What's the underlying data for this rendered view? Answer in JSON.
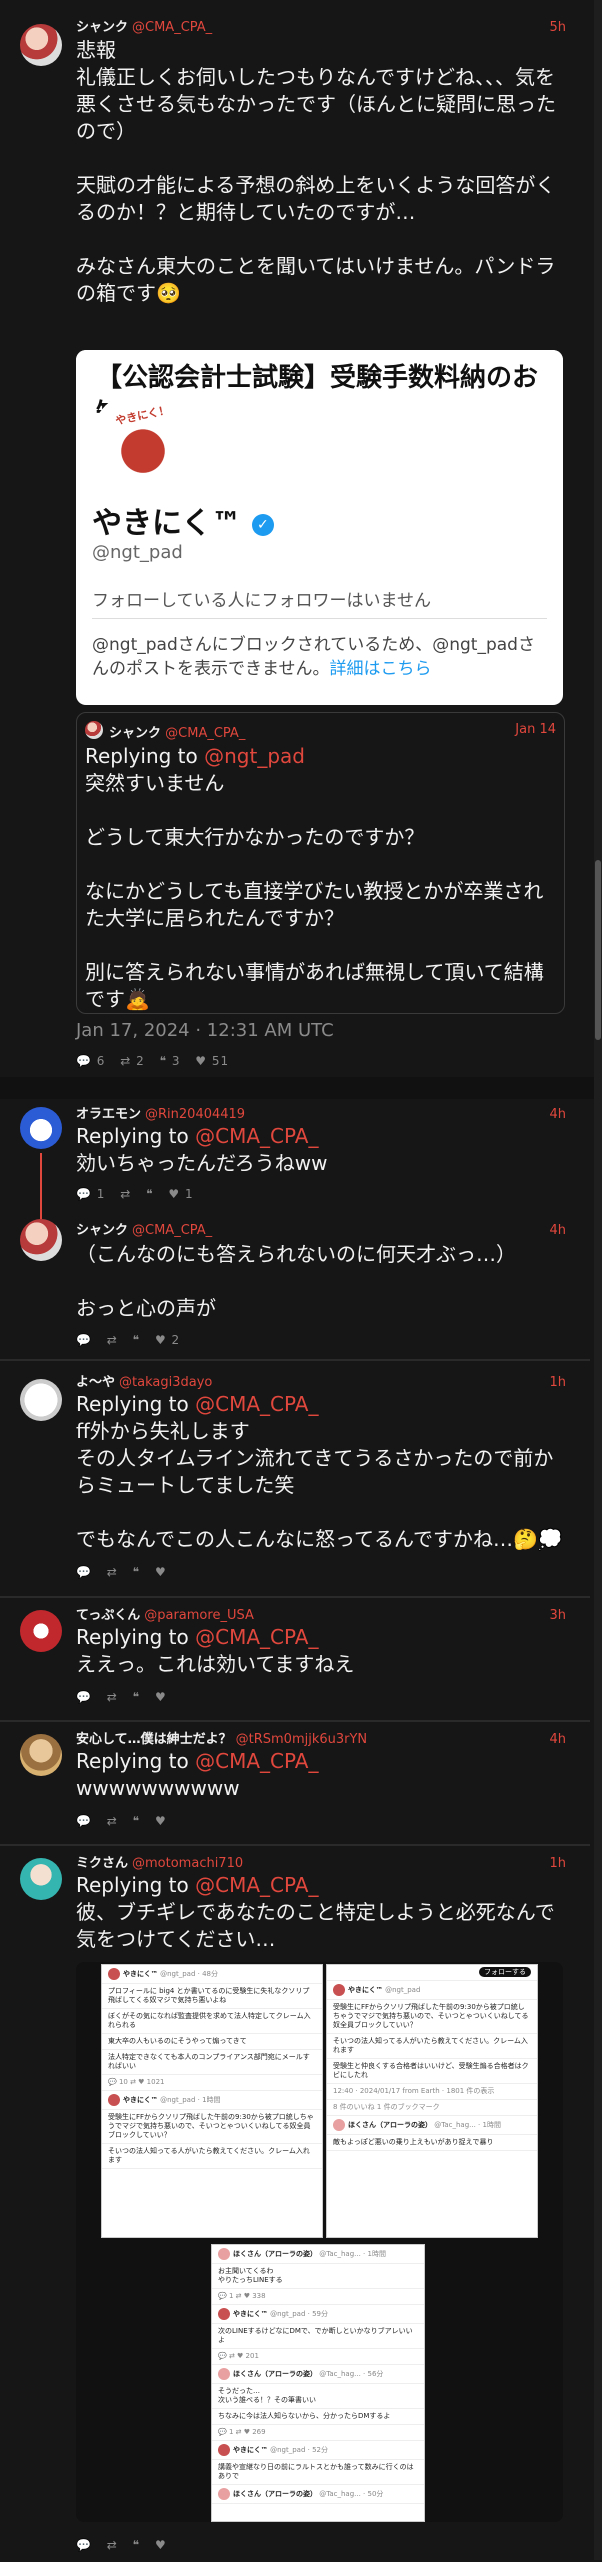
{
  "posts": [
    {
      "name": "シャンク",
      "handle": "@CMA_CPA_",
      "time": "5h",
      "body": "悲報\n礼儀正しくお伺いしたつもりなんですけどね、、、気を悪くさせる気もなかったです（ほんとに疑問に思ったので）\n\n天賦の才能による予想の斜め上をいくような回答がくるのか！？と期待していたのですが…\n\nみなさん東大のことを聞いてはいけません。パンドラの箱です🥺",
      "card": {
        "banner": "【公認会計士試験】受験手数料納のお知らせ",
        "banner_badge": "公",
        "logo_text": "やきにく！",
        "display_name": "やきにく™",
        "handle": "@ngt_pad",
        "followers_note": "フォローしている人にフォロワーはいません",
        "blocked_note": "@ngt_padさんにブロックされているため、@ngt_padさんのポストを表示できません。",
        "details_link": "詳細はこちら"
      },
      "quote": {
        "name": "シャンク",
        "handle": "@CMA_CPA_",
        "time": "Jan 14",
        "replying_prefix": "Replying to ",
        "replying_to": "@ngt_pad",
        "body": "突然すいません\n\nどうして東大行かなかったのですか？\n\nなにかどうしても直接学びたい教授とかが卒業された大学に居られたんですか？\n\n別に答えられない事情があれば無視して頂いて結構です🙇"
      },
      "timestamp": "Jan 17, 2024 · 12:31 AM UTC",
      "stats": [
        "💬 6",
        "⇄ 2",
        "❝ 3",
        "♥ 51"
      ]
    },
    {
      "name": "オラエモン",
      "handle": "@Rin20404419",
      "time": "4h",
      "replying_prefix": "Replying to ",
      "replying_to": "@CMA_CPA_",
      "body": "効いちゃったんだろうねww",
      "stats": [
        "💬 1",
        "⇄",
        "❝",
        "♥ 1"
      ]
    },
    {
      "name": "シャンク",
      "handle": "@CMA_CPA_",
      "time": "4h",
      "body": "（こんなのにも答えられないのに何天才ぶっ…）\n\nおっと心の声が",
      "stats": [
        "💬",
        "⇄",
        "❝",
        "♥ 2"
      ]
    },
    {
      "name": "よ〜や",
      "handle": "@takagi3dayo",
      "time": "1h",
      "replying_prefix": "Replying to ",
      "replying_to": "@CMA_CPA_",
      "body": "ff外から失礼します\nその人タイムライン流れてきてうるさかったので前からミュートしてました笑\n\nでもなんでこの人こんなに怒ってるんですかね…🤔💭",
      "stats": [
        "💬",
        "⇄",
        "❝",
        "♥"
      ]
    },
    {
      "name": "てっぷくん",
      "handle": "@paramore_USA",
      "time": "3h",
      "replying_prefix": "Replying to ",
      "replying_to": "@CMA_CPA_",
      "body": "ええっ。これは効いてますねえ",
      "stats": [
        "💬",
        "⇄",
        "❝",
        "♥"
      ]
    },
    {
      "name": "安心して…僕は紳士だよ？",
      "handle": "@tRSm0mjjk6u3rYN",
      "time": "4h",
      "replying_prefix": "Replying to ",
      "replying_to": "@CMA_CPA_",
      "body": "wwwwwwwwww",
      "stats": [
        "💬",
        "⇄",
        "❝",
        "♥"
      ]
    },
    {
      "name": "ミクさん",
      "handle": "@motomachi710",
      "time": "1h",
      "replying_prefix": "Replying to ",
      "replying_to": "@CMA_CPA_",
      "body": "彼、ブチギレであなたのこと特定しようと必死なんで気をつけてください…",
      "stats": [
        "💬",
        "⇄",
        "❝",
        "♥"
      ]
    }
  ],
  "embedded": {
    "s1_name": "やきにく™",
    "s1_handle": "@ngt_pad · 48分",
    "s1_text1": "プロフィールに big4 とか書いてるのに受験生に失礼なクソリプ飛ばしてくる奴マジで気持ち悪いよね",
    "s1_text2": "ぼくがその気になれば監査提供を求めて法人特定してクレーム入れられる",
    "s1_text3": "東大卒の人もいるのにそうやって煽ってきて",
    "s1_text4": "法人特定できなくても本人のコンプライアンス部門宛にメールすればいい",
    "s1_stats": "💬 10   ⇄   ♥ 1021",
    "s1b_handle": "@ngt_pad · 1時間",
    "s1b_text": "受験生にFFからクソリプ飛ばした午前の9:30から被プロ統しちゃうでマジで気持ち悪いので、そいつとゃついくいねしてる奴全員ブロックしていい？",
    "s1b_text2": "そいつの法人知ってる人がいたら教えてください。クレーム入れます",
    "s2_header": "フォローする",
    "s2_name": "やきにく™",
    "s2_handle": "@ngt_pad",
    "s2_text": "受験生にFFからクソリプ飛ばした午前の9:30から被プロ統しちゃうでマジで気持ち悪いので、そいつとゃついくいねしてる奴全員ブロックしていい？",
    "s2_text2": "そいつの法人知ってる人がいたら教えてください。クレーム入れます",
    "s2_text3": "受験生と仲良くする合格者はいいけど、受験生煽る合格者はクビにしたれ",
    "s2_time": "12:40 · 2024/01/17 from Earth · 1801 件の表示",
    "s2_bookmark": "8 件のいいね  1 件のブックマーク",
    "s2_reply_name": "ほくさん（アローラの姿）",
    "s2_reply_handle": "@Tac_hag... · 1時間",
    "s2_reply_text": "敵もよっぽど悪いの乗り上えもいがあり捉えで暴り",
    "s3_r1_name": "ほくさん（アローラの姿）",
    "s3_r1_meta": "@Tac_hag... · 1時間",
    "s3_r1_text": "お主聞いてくるわ\nやりたっちLINEする",
    "s3_r2_name": "やきにく™",
    "s3_r2_meta": "@ngt_pad · 59分",
    "s3_r2_text": "次のLINEするけどなにDMで、でか断しといかなりブアレいいよ",
    "s3_r3_name": "ほくさん（アローラの姿）",
    "s3_r3_meta": "@Tac_hag... · 56分",
    "s3_r3_text": "そうだった…\n次いう誰べる！？その筆書いい",
    "s3_r3_text2": "ちなみに今は法人知らないから、分かったらDMするよ",
    "s3_r4_name": "やきにく™",
    "s3_r4_meta": "@ngt_pad · 52分",
    "s3_r4_text": "講義や宣継なり日の前にラルトスとかも誰って数みに行くのはありで",
    "s3_r5_name": "ほくさん（アローラの姿）",
    "s3_r5_meta": "@Tac_hag... · 50分",
    "stat_a": "💬 1   ⇄   ♥ 338",
    "stat_b": "💬   ⇄   ♥ 201",
    "stat_c": "💬 1   ⇄   ♥ 269"
  }
}
